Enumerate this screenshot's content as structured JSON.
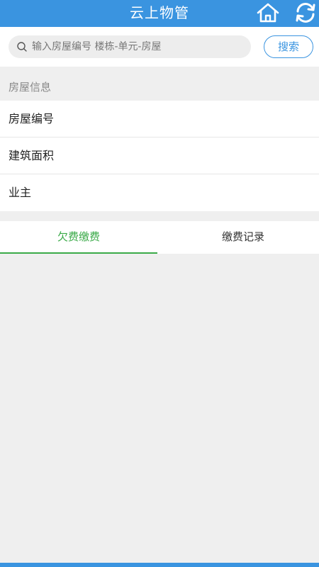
{
  "header": {
    "title": "云上物管",
    "home_icon": "home-icon",
    "refresh_icon": "refresh-icon",
    "color": "#3a94e0"
  },
  "search": {
    "placeholder": "输入房屋编号 楼栋-单元-房屋",
    "button_label": "搜索",
    "icon": "search-icon"
  },
  "section": {
    "title": "房屋信息"
  },
  "info_rows": [
    {
      "label": "房屋编号"
    },
    {
      "label": "建筑面积"
    },
    {
      "label": "业主"
    }
  ],
  "tabs": [
    {
      "label": "欠费缴费",
      "active": true,
      "color": "#3aaa48"
    },
    {
      "label": "缴费记录",
      "active": false
    }
  ]
}
